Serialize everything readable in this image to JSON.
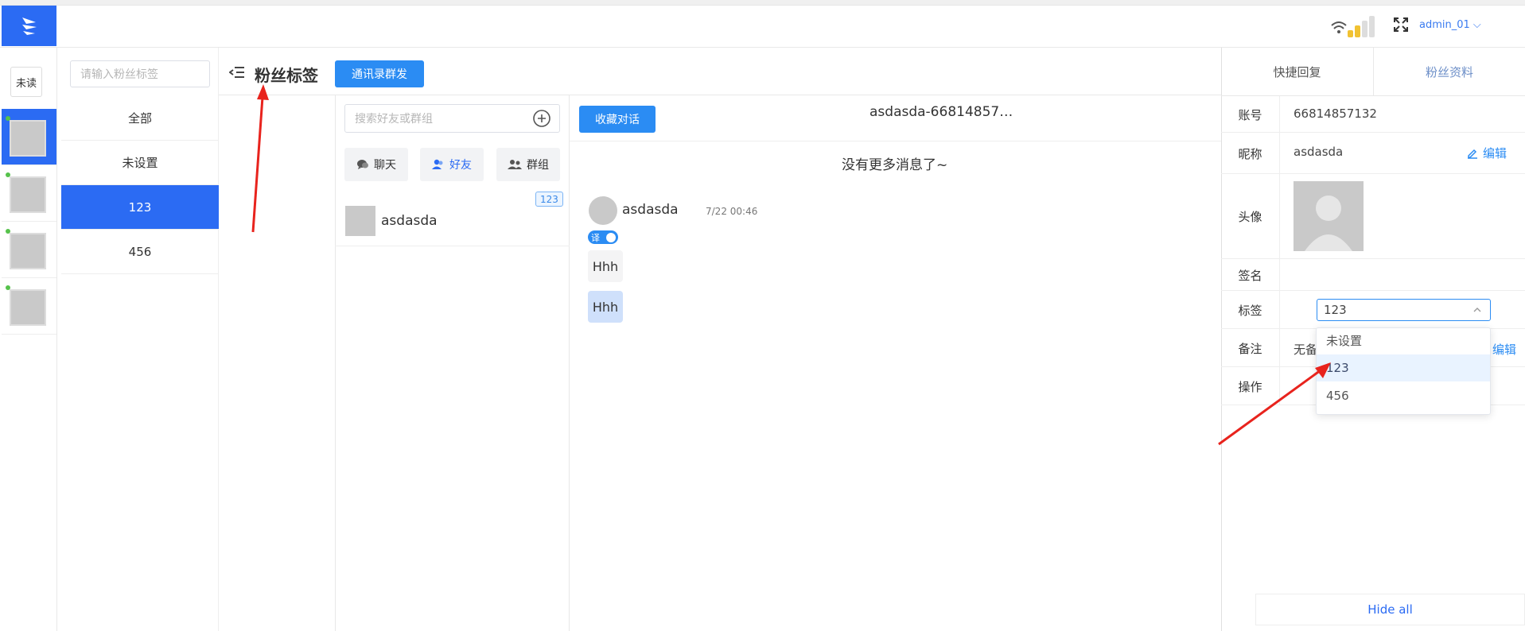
{
  "header": {
    "user_label": "admin_01 ⌵"
  },
  "rail": {
    "unread_label": "未读"
  },
  "tags_panel": {
    "search_placeholder": "请输入粉丝标签",
    "title": "粉丝标签",
    "items": [
      {
        "label": "全部"
      },
      {
        "label": "未设置"
      },
      {
        "label": "123"
      },
      {
        "label": "456"
      }
    ]
  },
  "toolbar": {
    "broadcast_label": "通讯录群发"
  },
  "contacts": {
    "search_placeholder": "搜索好友或群组",
    "tabs": [
      {
        "label": "聊天",
        "icon": "chat-icon"
      },
      {
        "label": "好友",
        "icon": "friend-icon"
      },
      {
        "label": "群组",
        "icon": "group-icon"
      }
    ],
    "list": [
      {
        "name": "asdasda",
        "badge": "123"
      }
    ]
  },
  "chat": {
    "favorite_label": "收藏对话",
    "title": "asdasda-66814857…",
    "no_more": "没有更多消息了~",
    "sender": "asdasda",
    "time": "7/22 00:46",
    "translate_label": "译",
    "messages": [
      {
        "text": "Hhh"
      },
      {
        "text": "Hhh"
      }
    ]
  },
  "right_panel": {
    "tabs": [
      {
        "label": "快捷回复"
      },
      {
        "label": "粉丝资料"
      }
    ],
    "rows": {
      "account": {
        "label": "账号",
        "value": "66814857132"
      },
      "nickname": {
        "label": "昵称",
        "value": "asdasda",
        "edit": "编辑"
      },
      "avatar": {
        "label": "头像"
      },
      "signature": {
        "label": "签名",
        "value": ""
      },
      "tag": {
        "label": "标签",
        "value": "123"
      },
      "remark": {
        "label": "备注",
        "value": "无备",
        "edit": "编辑"
      },
      "action": {
        "label": "操作"
      }
    },
    "dropdown_options": [
      {
        "label": "未设置"
      },
      {
        "label": "123"
      },
      {
        "label": "456"
      }
    ],
    "hide_all": "Hide all"
  },
  "colors": {
    "primary": "#2b6bf3",
    "button": "#2b8cf3",
    "arrow": "#e8231d",
    "online": "#56c24b"
  }
}
